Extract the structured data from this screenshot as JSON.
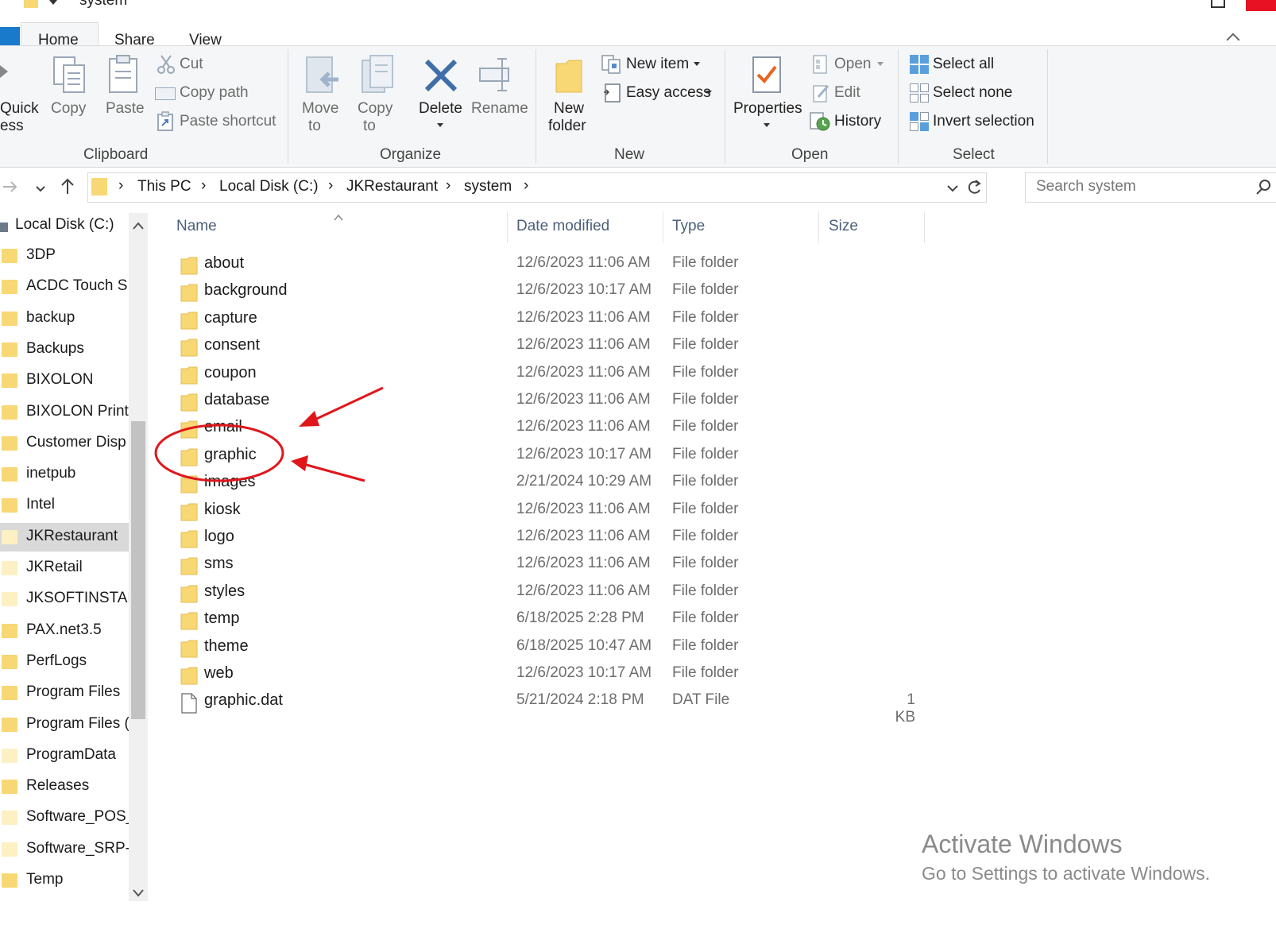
{
  "window": {
    "title": "system"
  },
  "tabs": {
    "home": "Home",
    "share": "Share",
    "view": "View"
  },
  "ribbon": {
    "clipboard": {
      "quick_access": "Quick",
      "quick_access_2": "ess",
      "copy": "Copy",
      "paste": "Paste",
      "cut": "Cut",
      "copy_path": "Copy path",
      "paste_shortcut": "Paste shortcut",
      "label": "Clipboard"
    },
    "organize": {
      "move_to": "Move",
      "move_to_2": "to",
      "copy_to": "Copy",
      "copy_to_2": "to",
      "delete": "Delete",
      "rename": "Rename",
      "label": "Organize"
    },
    "new": {
      "new_folder": "New",
      "new_folder_2": "folder",
      "new_item": "New item",
      "easy_access": "Easy access",
      "label": "New"
    },
    "open": {
      "properties": "Properties",
      "open": "Open",
      "edit": "Edit",
      "history": "History",
      "label": "Open"
    },
    "select": {
      "select_all": "Select all",
      "select_none": "Select none",
      "invert_selection": "Invert selection",
      "label": "Select"
    }
  },
  "address": {
    "crumbs": [
      "This PC",
      "Local Disk (C:)",
      "JKRestaurant",
      "system"
    ],
    "search_placeholder": "Search system"
  },
  "nav": {
    "root": "Local Disk (C:)",
    "items": [
      "3DP",
      "ACDC Touch S",
      "backup",
      "Backups",
      "BIXOLON",
      "BIXOLON Print",
      "Customer Disp",
      "inetpub",
      "Intel",
      "JKRestaurant",
      "JKRetail",
      "JKSOFTINSTAL",
      "PAX.net3.5",
      "PerfLogs",
      "Program Files",
      "Program Files (",
      "ProgramData",
      "Releases",
      "Software_POS_",
      "Software_SRP-",
      "Temp"
    ],
    "selected": "JKRestaurant"
  },
  "columns": {
    "name": "Name",
    "date": "Date modified",
    "type": "Type",
    "size": "Size"
  },
  "files": [
    {
      "name": "about",
      "date": "12/6/2023 11:06 AM",
      "type": "File folder",
      "size": ""
    },
    {
      "name": "background",
      "date": "12/6/2023 10:17 AM",
      "type": "File folder",
      "size": ""
    },
    {
      "name": "capture",
      "date": "12/6/2023 11:06 AM",
      "type": "File folder",
      "size": ""
    },
    {
      "name": "consent",
      "date": "12/6/2023 11:06 AM",
      "type": "File folder",
      "size": ""
    },
    {
      "name": "coupon",
      "date": "12/6/2023 11:06 AM",
      "type": "File folder",
      "size": ""
    },
    {
      "name": "database",
      "date": "12/6/2023 11:06 AM",
      "type": "File folder",
      "size": ""
    },
    {
      "name": "email",
      "date": "12/6/2023 11:06 AM",
      "type": "File folder",
      "size": ""
    },
    {
      "name": "graphic",
      "date": "12/6/2023 10:17 AM",
      "type": "File folder",
      "size": ""
    },
    {
      "name": "images",
      "date": "2/21/2024 10:29 AM",
      "type": "File folder",
      "size": ""
    },
    {
      "name": "kiosk",
      "date": "12/6/2023 11:06 AM",
      "type": "File folder",
      "size": ""
    },
    {
      "name": "logo",
      "date": "12/6/2023 11:06 AM",
      "type": "File folder",
      "size": ""
    },
    {
      "name": "sms",
      "date": "12/6/2023 11:06 AM",
      "type": "File folder",
      "size": ""
    },
    {
      "name": "styles",
      "date": "12/6/2023 11:06 AM",
      "type": "File folder",
      "size": ""
    },
    {
      "name": "temp",
      "date": "6/18/2025 2:28 PM",
      "type": "File folder",
      "size": ""
    },
    {
      "name": "theme",
      "date": "6/18/2025 10:47 AM",
      "type": "File folder",
      "size": ""
    },
    {
      "name": "web",
      "date": "12/6/2023 10:17 AM",
      "type": "File folder",
      "size": ""
    },
    {
      "name": "graphic.dat",
      "date": "5/21/2024 2:18 PM",
      "type": "DAT File",
      "size": "1 KB"
    }
  ],
  "watermark": {
    "line1": "Activate Windows",
    "line2": "Go to Settings to activate Windows."
  },
  "colors": {
    "accent": "#1979ca",
    "folder": "#f8d775",
    "annotation": "#e0161b"
  }
}
